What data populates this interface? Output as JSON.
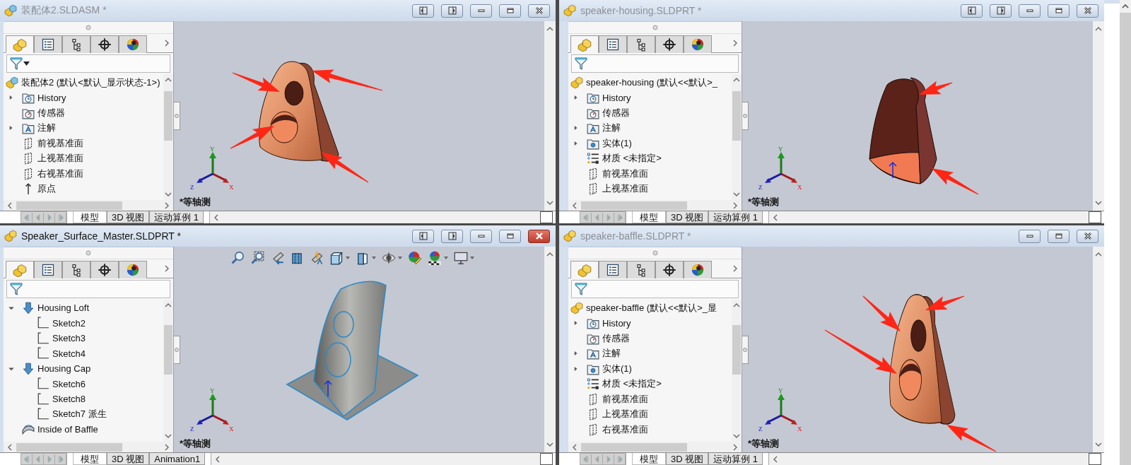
{
  "windows": [
    {
      "title": "装配体2.SLDASM *",
      "kind": "assembly",
      "active": false,
      "tile_buttons": true,
      "heads_up_toolbar": false,
      "filter_menu": true,
      "model": {
        "kind": "baffle-assembly"
      },
      "panel_tabs": [
        {
          "kind": "feature",
          "selected": true
        },
        {
          "kind": "property",
          "selected": false
        },
        {
          "kind": "config",
          "selected": false
        },
        {
          "kind": "target",
          "selected": false
        },
        {
          "kind": "display",
          "selected": false
        }
      ],
      "root": {
        "label": "装配体2 (默认<默认_显示状态-1>)",
        "kind": "assembly"
      },
      "tree": [
        {
          "label": "History",
          "kind": "history",
          "expandable": true,
          "expanded": false
        },
        {
          "label": "传感器",
          "kind": "sensor",
          "expandable": false
        },
        {
          "label": "注解",
          "kind": "annotation",
          "expandable": true,
          "expanded": false
        },
        {
          "label": "前视基准面",
          "kind": "plane",
          "expandable": false
        },
        {
          "label": "上视基准面",
          "kind": "plane",
          "expandable": false
        },
        {
          "label": "右视基准面",
          "kind": "plane",
          "expandable": false
        },
        {
          "label": "原点",
          "kind": "origin",
          "expandable": false
        }
      ],
      "view_label": "*等轴测",
      "triad": {
        "x": "X",
        "y": "Y",
        "z": "Z"
      },
      "bottom_tabs": [
        {
          "label": "模型",
          "selected": true
        },
        {
          "label": "3D 视图",
          "selected": false
        },
        {
          "label": "运动算例 1",
          "selected": false
        }
      ]
    },
    {
      "title": "speaker-housing.SLDPRT *",
      "kind": "part",
      "active": false,
      "tile_buttons": true,
      "heads_up_toolbar": false,
      "filter_menu": false,
      "model": {
        "kind": "housing"
      },
      "panel_tabs": [
        {
          "kind": "feature",
          "selected": true
        },
        {
          "kind": "property",
          "selected": false
        },
        {
          "kind": "config",
          "selected": false
        },
        {
          "kind": "target",
          "selected": false
        },
        {
          "kind": "display",
          "selected": false
        }
      ],
      "root": {
        "label": "speaker-housing (默认<<默认>_",
        "kind": "part"
      },
      "tree": [
        {
          "label": "History",
          "kind": "history",
          "expandable": true,
          "expanded": false
        },
        {
          "label": "传感器",
          "kind": "sensor",
          "expandable": false
        },
        {
          "label": "注解",
          "kind": "annotation",
          "expandable": true,
          "expanded": false
        },
        {
          "label": "实体(1)",
          "kind": "solid",
          "expandable": true,
          "expanded": false
        },
        {
          "label": "材质 <未指定>",
          "kind": "material",
          "expandable": false
        },
        {
          "label": "前视基准面",
          "kind": "plane",
          "expandable": false
        },
        {
          "label": "上视基准面",
          "kind": "plane",
          "expandable": false
        }
      ],
      "view_label": "*等轴测",
      "triad": {
        "x": "X",
        "y": "Y",
        "z": "Z"
      },
      "bottom_tabs": [
        {
          "label": "模型",
          "selected": true
        },
        {
          "label": "3D 视图",
          "selected": false
        },
        {
          "label": "运动算例 1",
          "selected": false
        }
      ]
    },
    {
      "title": "Speaker_Surface_Master.SLDPRT *",
      "kind": "part",
      "active": true,
      "tile_buttons": true,
      "heads_up_toolbar": true,
      "filter_menu": false,
      "model": {
        "kind": "surface"
      },
      "panel_tabs": [
        {
          "kind": "feature",
          "selected": true
        },
        {
          "kind": "property",
          "selected": false
        },
        {
          "kind": "config",
          "selected": false
        },
        {
          "kind": "target",
          "selected": false
        },
        {
          "kind": "display",
          "selected": false
        }
      ],
      "tree": [
        {
          "label": "Housing Loft",
          "kind": "feature",
          "expandable": true,
          "expanded": true,
          "children": [
            {
              "label": "Sketch2",
              "kind": "sketch",
              "expandable": false
            },
            {
              "label": "Sketch3",
              "kind": "sketch",
              "expandable": false
            },
            {
              "label": "Sketch4",
              "kind": "sketch",
              "expandable": false
            }
          ]
        },
        {
          "label": "Housing Cap",
          "kind": "feature",
          "expandable": true,
          "expanded": true,
          "children": [
            {
              "label": "Sketch6",
              "kind": "sketch",
              "expandable": false
            },
            {
              "label": "Sketch8",
              "kind": "sketch",
              "expandable": false
            },
            {
              "label": "Sketch7 派生",
              "kind": "sketch",
              "expandable": false
            }
          ]
        },
        {
          "label": "Inside of Baffle",
          "kind": "surface",
          "expandable": false
        }
      ],
      "view_label": "*等轴测",
      "triad": {
        "x": "X",
        "y": "Y",
        "z": "Z"
      },
      "bottom_tabs": [
        {
          "label": "模型",
          "selected": true
        },
        {
          "label": "3D 视图",
          "selected": false
        },
        {
          "label": "Animation1",
          "selected": false
        }
      ]
    },
    {
      "title": "speaker-baffle.SLDPRT *",
      "kind": "part",
      "active": false,
      "tile_buttons": false,
      "heads_up_toolbar": false,
      "filter_menu": false,
      "model": {
        "kind": "baffle"
      },
      "panel_tabs": [
        {
          "kind": "feature",
          "selected": true
        },
        {
          "kind": "property",
          "selected": false
        },
        {
          "kind": "config",
          "selected": false
        },
        {
          "kind": "target",
          "selected": false
        },
        {
          "kind": "display",
          "selected": false
        }
      ],
      "root": {
        "label": "speaker-baffle (默认<<默认>_显",
        "kind": "part"
      },
      "tree": [
        {
          "label": "History",
          "kind": "history",
          "expandable": true,
          "expanded": false
        },
        {
          "label": "传感器",
          "kind": "sensor",
          "expandable": false
        },
        {
          "label": "注解",
          "kind": "annotation",
          "expandable": true,
          "expanded": false
        },
        {
          "label": "实体(1)",
          "kind": "solid",
          "expandable": true,
          "expanded": false
        },
        {
          "label": "材质 <未指定>",
          "kind": "material",
          "expandable": false
        },
        {
          "label": "前视基准面",
          "kind": "plane",
          "expandable": false
        },
        {
          "label": "上视基准面",
          "kind": "plane",
          "expandable": false
        },
        {
          "label": "右视基准面",
          "kind": "plane",
          "expandable": false
        }
      ],
      "view_label": "*等轴测",
      "triad": {
        "x": "X",
        "y": "Y",
        "z": "Z"
      },
      "bottom_tabs": [
        {
          "label": "模型",
          "selected": true
        },
        {
          "label": "3D 视图",
          "selected": false
        },
        {
          "label": "运动算例 1",
          "selected": false
        }
      ]
    }
  ]
}
